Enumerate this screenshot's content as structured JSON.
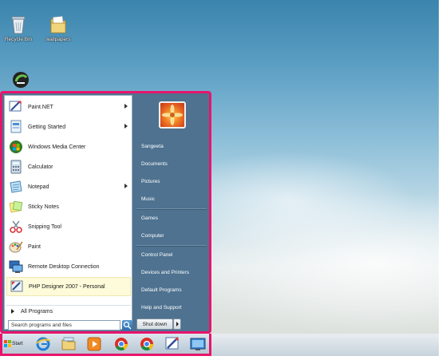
{
  "desktop": {
    "icons": [
      {
        "label": "Recycle Bin",
        "icon": "recycle-bin-icon"
      },
      {
        "label": "wallpapers",
        "icon": "folder-icon"
      }
    ]
  },
  "start_menu": {
    "programs": [
      {
        "label": "Paint.NET",
        "icon": "paint-net-icon",
        "submenu": true
      },
      {
        "label": "Getting Started",
        "icon": "getting-started-icon",
        "submenu": true
      },
      {
        "label": "Windows Media Center",
        "icon": "media-center-icon",
        "submenu": false
      },
      {
        "label": "Calculator",
        "icon": "calculator-icon",
        "submenu": false
      },
      {
        "label": "Notepad",
        "icon": "notepad-icon",
        "submenu": true
      },
      {
        "label": "Sticky Notes",
        "icon": "sticky-notes-icon",
        "submenu": false
      },
      {
        "label": "Snipping Tool",
        "icon": "snipping-tool-icon",
        "submenu": false
      },
      {
        "label": "Paint",
        "icon": "paint-icon",
        "submenu": false
      },
      {
        "label": "Remote Desktop Connection",
        "icon": "remote-desktop-icon",
        "submenu": false
      },
      {
        "label": "PHP Designer 2007 - Personal",
        "icon": "php-designer-icon",
        "submenu": false
      }
    ],
    "all_programs": "All Programs",
    "search_placeholder": "Search programs and files",
    "right_items": [
      "Sangeeta",
      "Documents",
      "Pictures",
      "Music",
      "Games",
      "Computer",
      "Control Panel",
      "Devices and Printers",
      "Default Programs",
      "Help and Support"
    ],
    "shutdown_label": "Shut down"
  },
  "taskbar": {
    "start_label": "Start",
    "pinned": [
      "internet-explorer-icon",
      "file-explorer-icon",
      "media-player-icon",
      "chrome-icon",
      "chrome-icon",
      "paint-net-icon",
      "remote-desktop-icon"
    ]
  },
  "colors": {
    "highlight_border": "#e8146c",
    "menu_right_bg": "#4e7290"
  }
}
